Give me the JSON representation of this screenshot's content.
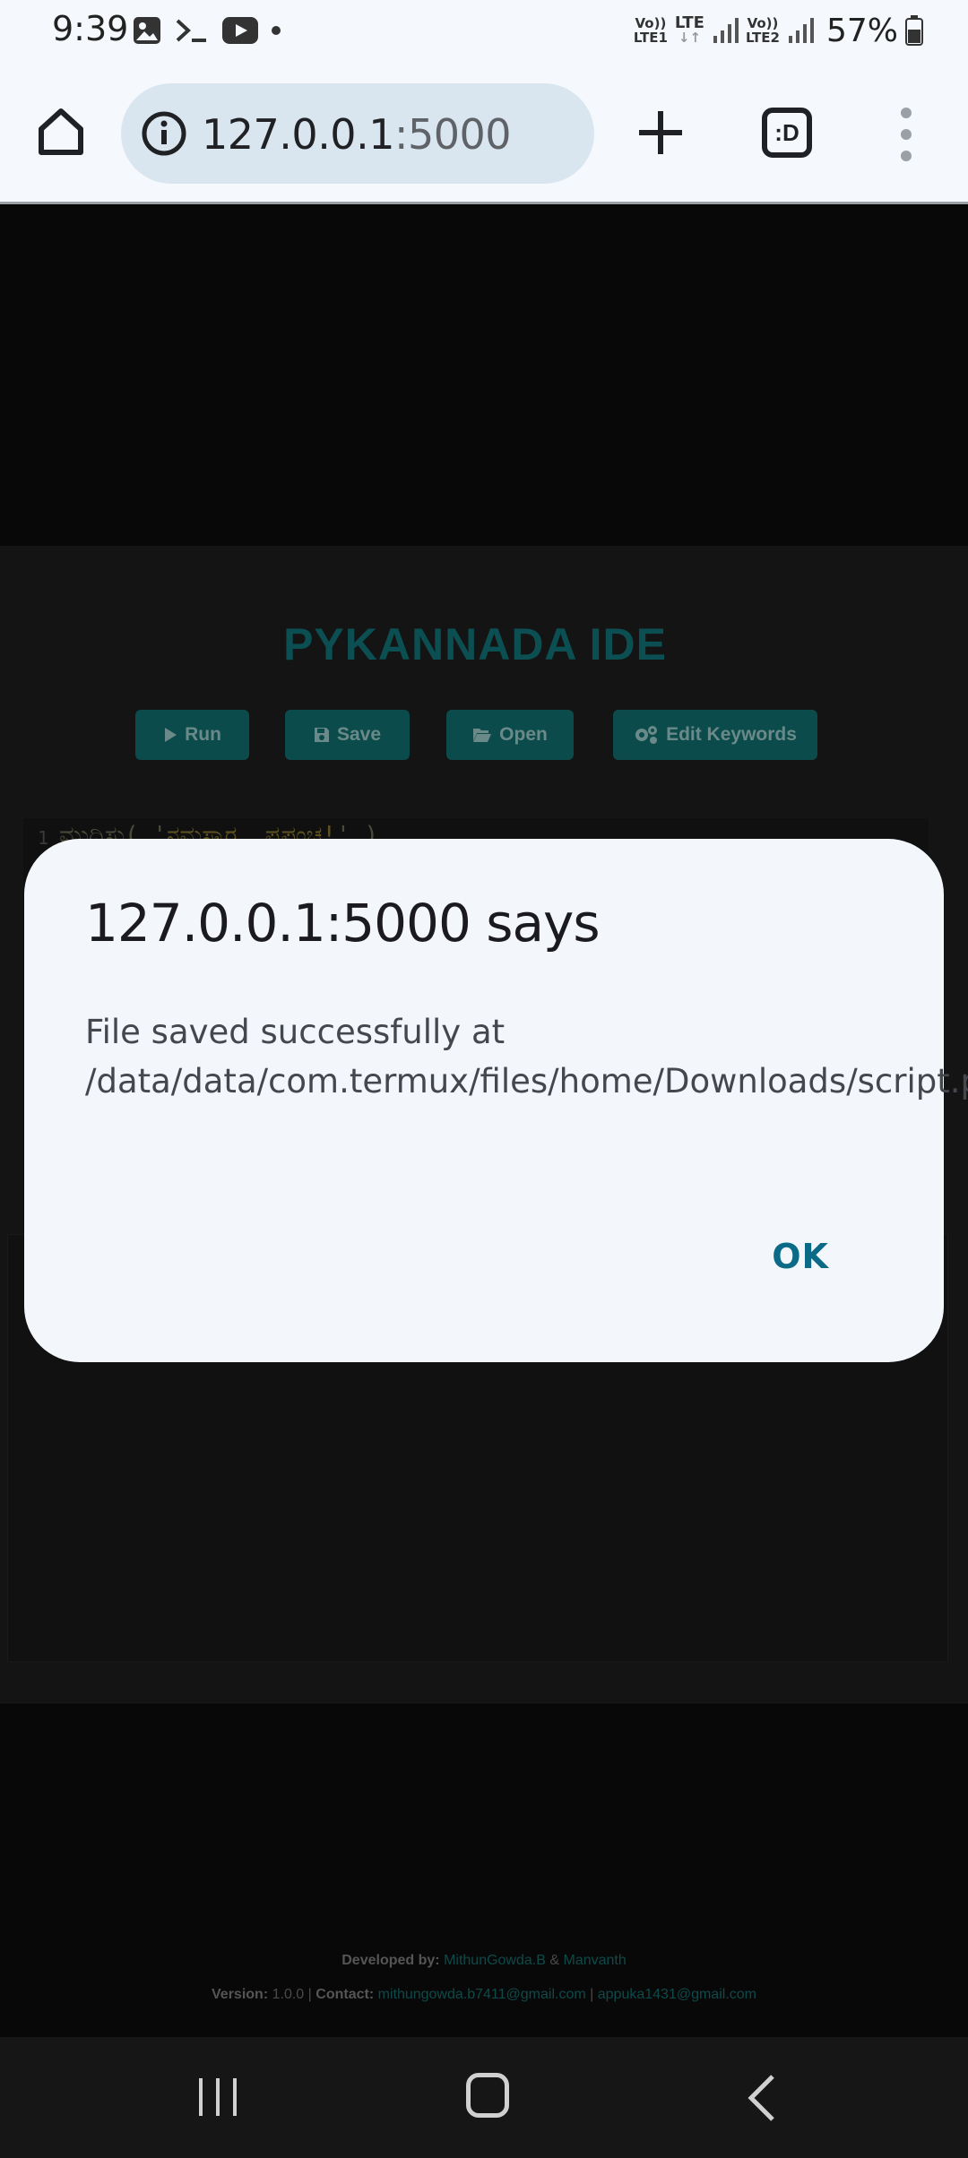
{
  "status_bar": {
    "time": "9:39",
    "left_icons": [
      "gallery-icon",
      "terminal-icon",
      "youtube-icon",
      "dot-icon"
    ],
    "sim1_label_top": "Vo))",
    "sim1_label_bottom": "LTE1",
    "lte_label": "LTE",
    "sim2_label_top": "Vo))",
    "sim2_label_bottom": "LTE2",
    "battery": "57%"
  },
  "browser": {
    "url_host": "127.0.0.1",
    "url_port": ":5000",
    "tabs_label": ":D"
  },
  "app": {
    "title": "PYKANNADA IDE",
    "buttons": {
      "run": "Run",
      "save": "Save",
      "open": "Open",
      "edit_keywords": "Edit Keywords"
    },
    "editor": {
      "line_number": "1",
      "code_keyword": "ಮುದ್ರಿಸು",
      "code_open": "( '",
      "code_string": "ನಮಸ್ಕಾರ, ಪ್ರಪಂಚ!",
      "code_close": "' )"
    },
    "footer": {
      "developed_by_label": "Developed by:",
      "dev1": "MithunGowda.B",
      "amp": "&",
      "dev2": "Manvanth",
      "version_label": "Version:",
      "version": "1.0.0",
      "sep1": "|",
      "contact_label": "Contact:",
      "email1": "mithungowda.b7411@gmail.com",
      "sep2": "|",
      "email2": "appuka1431@gmail.com"
    }
  },
  "dialog": {
    "title": "127.0.0.1:5000 says",
    "message": "File saved successfully at /data/data/com.termux/files/home/Downloads/script.py",
    "ok_label": "OK"
  },
  "colors": {
    "accent": "#0b6b87",
    "app_button": "#0c4b4b",
    "app_title": "#0b4f52"
  }
}
